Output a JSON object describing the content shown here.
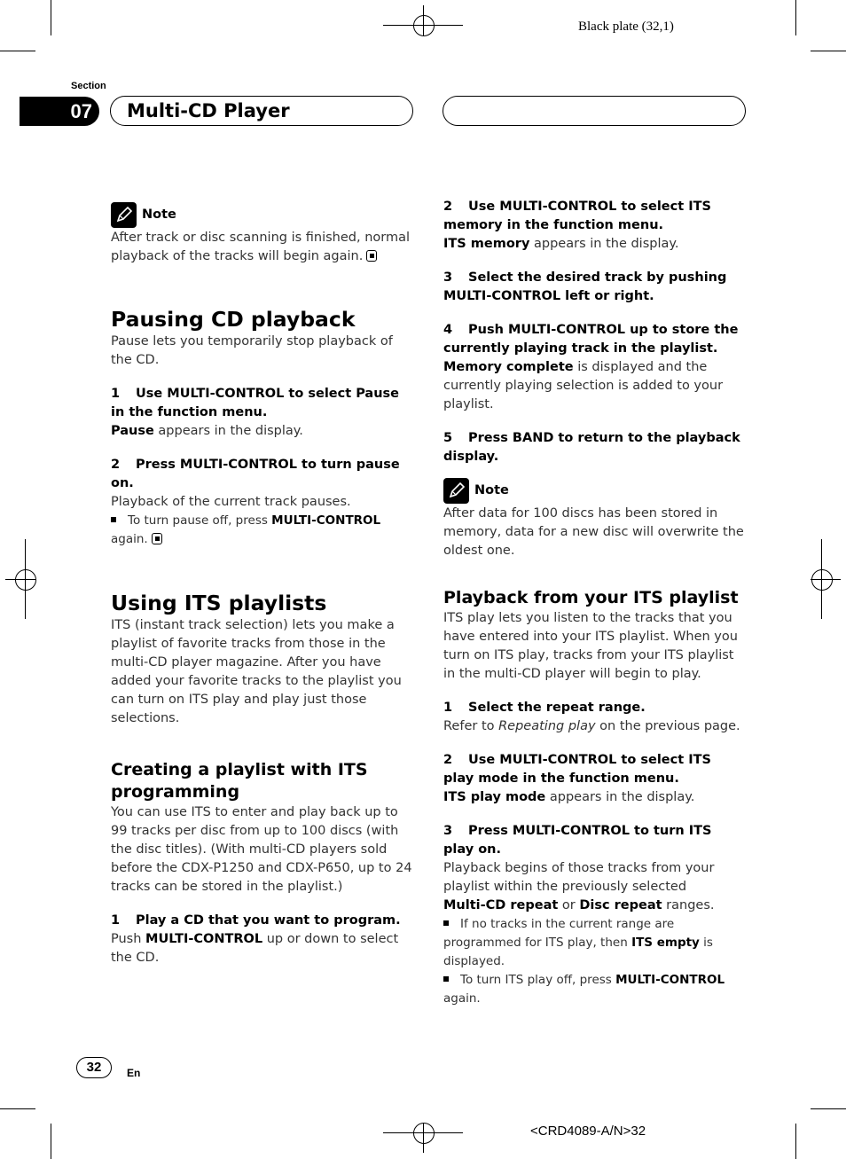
{
  "plate_label": "Black plate (32,1)",
  "header": {
    "section_label": "Section",
    "section_number": "07",
    "section_title": "Multi-CD Player"
  },
  "left": {
    "note1": {
      "label": "Note",
      "text": "After track or disc scanning is finished, normal playback of the tracks will begin again."
    },
    "pausing": {
      "title": "Pausing CD playback",
      "intro": "Pause lets you temporarily stop playback of the CD.",
      "step1": {
        "num": "1",
        "text": "Use MULTI-CONTROL to select Pause in the function menu.",
        "desc_bold": "Pause",
        "desc_rest": " appears in the display."
      },
      "step2": {
        "num": "2",
        "text": "Press MULTI-CONTROL to turn pause on.",
        "desc": "Playback of the current track pauses.",
        "bullet_pre": "To turn pause off, press ",
        "bullet_bold": "MULTI-CONTROL",
        "bullet_post": " again."
      }
    },
    "its": {
      "title": "Using ITS playlists",
      "intro": "ITS (instant track selection) lets you make a playlist of favorite tracks from those in the multi-CD player magazine. After you have added your favorite tracks to the playlist you can turn on ITS play and play just those selections."
    },
    "creating": {
      "title": "Creating a playlist with ITS programming",
      "intro": "You can use ITS to enter and play back up to 99 tracks per disc from up to 100 discs (with the disc titles). (With multi-CD players sold before the CDX-P1250 and CDX-P650, up to 24 tracks can be stored in the playlist.)",
      "step1": {
        "num": "1",
        "text": "Play a CD that you want to program.",
        "desc_pre": "Push ",
        "desc_bold": "MULTI-CONTROL",
        "desc_post": " up or down to select the CD."
      }
    }
  },
  "right": {
    "step2": {
      "num": "2",
      "text": "Use MULTI-CONTROL to select ITS memory in the function menu.",
      "desc_bold": "ITS memory",
      "desc_rest": " appears in the display."
    },
    "step3": {
      "num": "3",
      "text": "Select the desired track by pushing MULTI-CONTROL left or right."
    },
    "step4": {
      "num": "4",
      "text": "Push MULTI-CONTROL up to store the currently playing track in the playlist.",
      "desc_bold": "Memory complete",
      "desc_rest": " is displayed and the currently playing selection is added to your playlist."
    },
    "step5": {
      "num": "5",
      "text": "Press BAND to return to the playback display."
    },
    "note2": {
      "label": "Note",
      "text": "After data for 100 discs has been stored in memory, data for a new disc will overwrite the oldest one."
    },
    "playback": {
      "title": "Playback from your ITS playlist",
      "intro": "ITS play lets you listen to the tracks that you have entered into your ITS playlist. When you turn on ITS play, tracks from your ITS playlist in the multi-CD player will begin to play.",
      "step1": {
        "num": "1",
        "text": "Select the repeat range.",
        "desc_pre": "Refer to ",
        "desc_italic": "Repeating play",
        "desc_post": " on the previous page."
      },
      "step2": {
        "num": "2",
        "text": "Use MULTI-CONTROL to select ITS play mode in the function menu.",
        "desc_bold": "ITS play mode",
        "desc_rest": " appears in the display."
      },
      "step3": {
        "num": "3",
        "text": "Press MULTI-CONTROL to turn ITS play on.",
        "desc": "Playback begins of those tracks from your playlist within the previously selected",
        "desc_bold1": "Multi-CD repeat",
        "desc_mid": " or ",
        "desc_bold2": "Disc repeat",
        "desc_end": " ranges.",
        "bullet1_pre": "If no tracks in the current range are programmed for ITS play, then ",
        "bullet1_bold": "ITS empty",
        "bullet1_post": " is displayed.",
        "bullet2_pre": "To turn ITS play off, press ",
        "bullet2_bold": "MULTI-CONTROL",
        "bullet2_post": " again."
      }
    }
  },
  "footer": {
    "page_number": "32",
    "language": "En",
    "doc_code": "<CRD4089-A/N>32"
  }
}
